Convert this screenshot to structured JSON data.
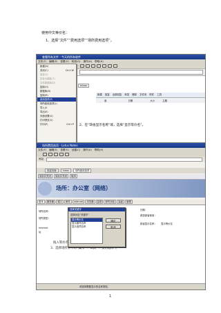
{
  "doc": {
    "section1_title": "使用中文等价名：",
    "step1": "1、选择“文件”“费用选项”“场所费用选项”。",
    "caption_mid": "2、在“缺省显示名称”域，选择“显示等价名”。",
    "section3_title": "插入等价名：",
    "step3": "3、选择场所条中的“操作”→“工具”→“费用选项”。",
    "page_number": "1"
  },
  "shot1": {
    "title": "查看所有文件 - 今天的所有收件",
    "menu": [
      "文件(F)",
      "编辑(E)",
      "查看(V)",
      "转到(G)",
      "操作(A)",
      "帮助(H)"
    ],
    "file_menu": [
      {
        "label": "新建(N)",
        "shortcut": ""
      },
      {
        "label": "关闭(C)",
        "shortcut": "Ctrl+W"
      },
      {
        "label": "保存(S)",
        "shortcut": ""
      },
      {
        "label": "另存为模板(T)",
        "shortcut": ""
      },
      {
        "label": "文件数据库(D)",
        "shortcut": ""
      },
      {
        "label": "复制(O)",
        "shortcut": ""
      },
      {
        "label": "数据库(B)",
        "shortcut": ""
      },
      {
        "label": "复制(R)",
        "shortcut": ""
      },
      {
        "label": "费用选项(P)",
        "shortcut": ""
      },
      {
        "label": "场所费用选项(L)",
        "shortcut": ""
      },
      {
        "label": "导入(I)",
        "shortcut": ""
      },
      {
        "label": "导出(E)",
        "shortcut": ""
      },
      {
        "label": "页面设置(U)",
        "shortcut": ""
      },
      {
        "label": "打印预览(V)",
        "shortcut": ""
      },
      {
        "label": "打印(P)",
        "shortcut": "Ctrl+P"
      }
    ],
    "tab_label": "Inbox",
    "columns": [
      "谁",
      "日期",
      "大小",
      "主题"
    ],
    "tabs_row": [
      "新建",
      "回复",
      "全部回复",
      "转发",
      "删除",
      "文件夹",
      "附件",
      "工具"
    ]
  },
  "shot2": {
    "title": "场所费用选项 - Lotus Notes",
    "menu": [
      "文件(F)",
      "编辑(E)",
      "查看(V)",
      "创建(C)",
      "操作(A)",
      "帮助(H)"
    ],
    "address_label": "地址",
    "tabs": [
      "欢迎页面",
      "Inbox",
      "场所费用选项"
    ],
    "action_bar": [
      "保存并关闭",
      "保存并关闭",
      "取消"
    ],
    "header": "场所：办公室（网络）",
    "section_tabs": [
      "基本",
      "服务器",
      "端口",
      "邮件",
      "Internet",
      "浏览器",
      "复制",
      "即时消息",
      "高级",
      "管理"
    ],
    "left_labels": [
      "场所名称：",
      "场所类型：",
      "Internet",
      "址"
    ],
    "right_labels": [
      "缺省显示名称：",
      "首选缺省使用：",
      "日期："
    ],
    "right_value": "显示等价名",
    "dialog": {
      "title": "选择关键字",
      "prompt": "选择对应\"关键字\"",
      "items": [
        "显示等价名",
        "显示缩写名称",
        "显示选项名称"
      ],
      "ok": "确定",
      "cancel": "取消"
    },
    "status": "请选择需要显示的名称类型。"
  }
}
